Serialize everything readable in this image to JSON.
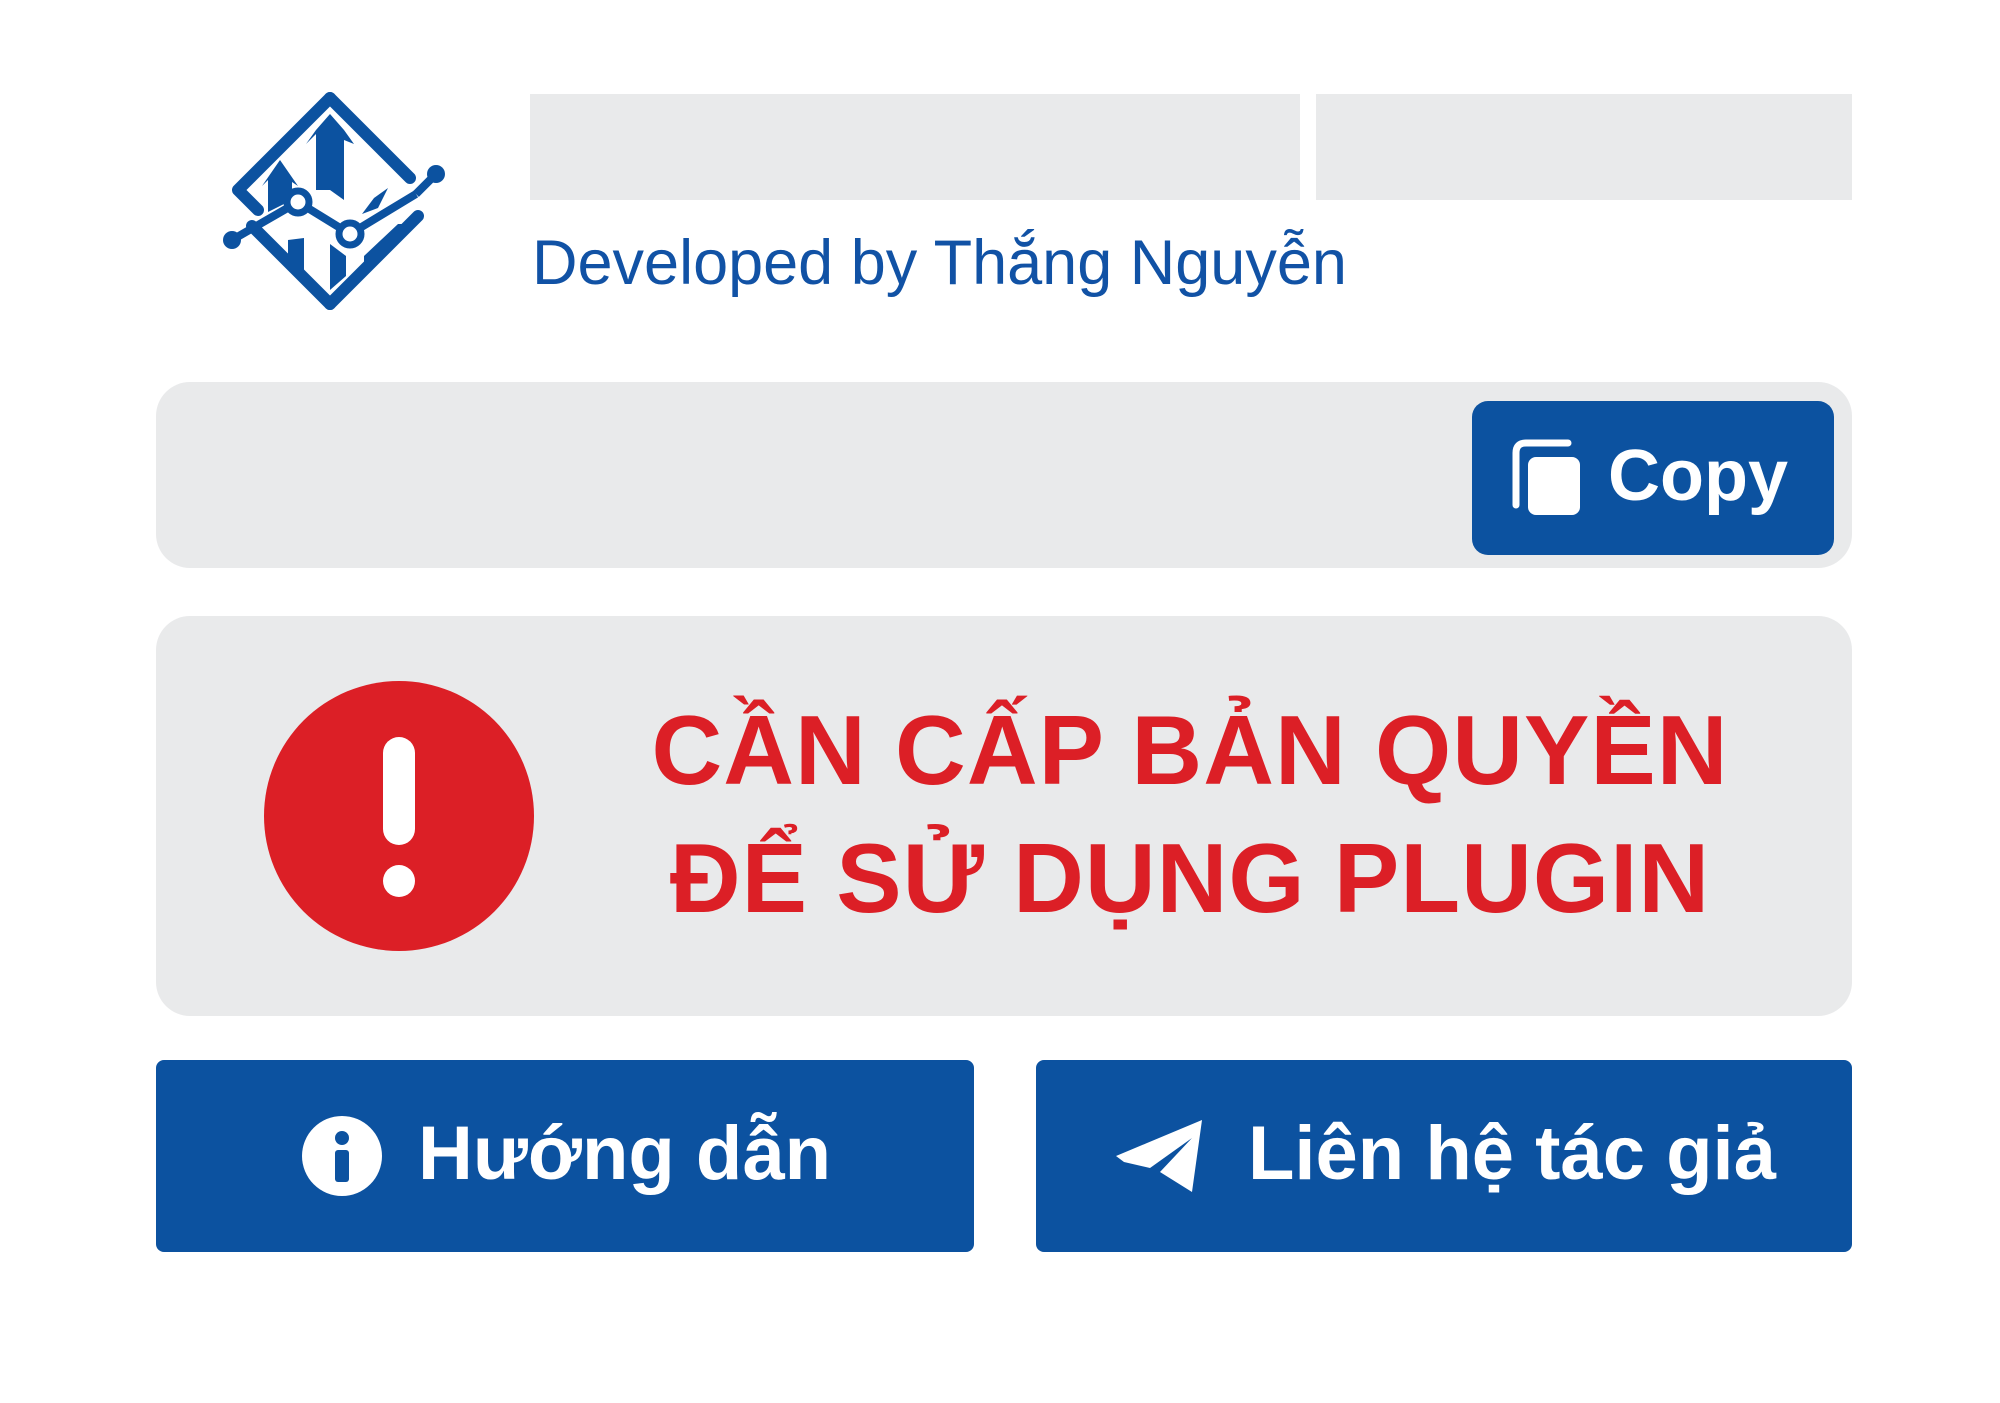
{
  "header": {
    "logo_icon": "chart-diamond-logo-icon",
    "credit": "Developed by Thắng Nguyễn",
    "fields": [
      {
        "value": ""
      },
      {
        "value": ""
      }
    ]
  },
  "key": {
    "value": "",
    "copy_label": "Copy",
    "copy_icon": "copy-icon"
  },
  "alert": {
    "icon": "exclamation-circle-icon",
    "line1": "CẦN CẤP BẢN QUYỀN",
    "line2": "ĐỂ SỬ DỤNG PLUGIN"
  },
  "actions": {
    "guide_label": "Hướng dẫn",
    "guide_icon": "info-circle-icon",
    "contact_label": "Liên hệ tác giả",
    "contact_icon": "paper-plane-icon"
  },
  "colors": {
    "brand_blue": "#0c52a0",
    "text_blue": "#1152a5",
    "alert_red": "#dc1f26",
    "panel_gray": "#e9eaeb"
  }
}
